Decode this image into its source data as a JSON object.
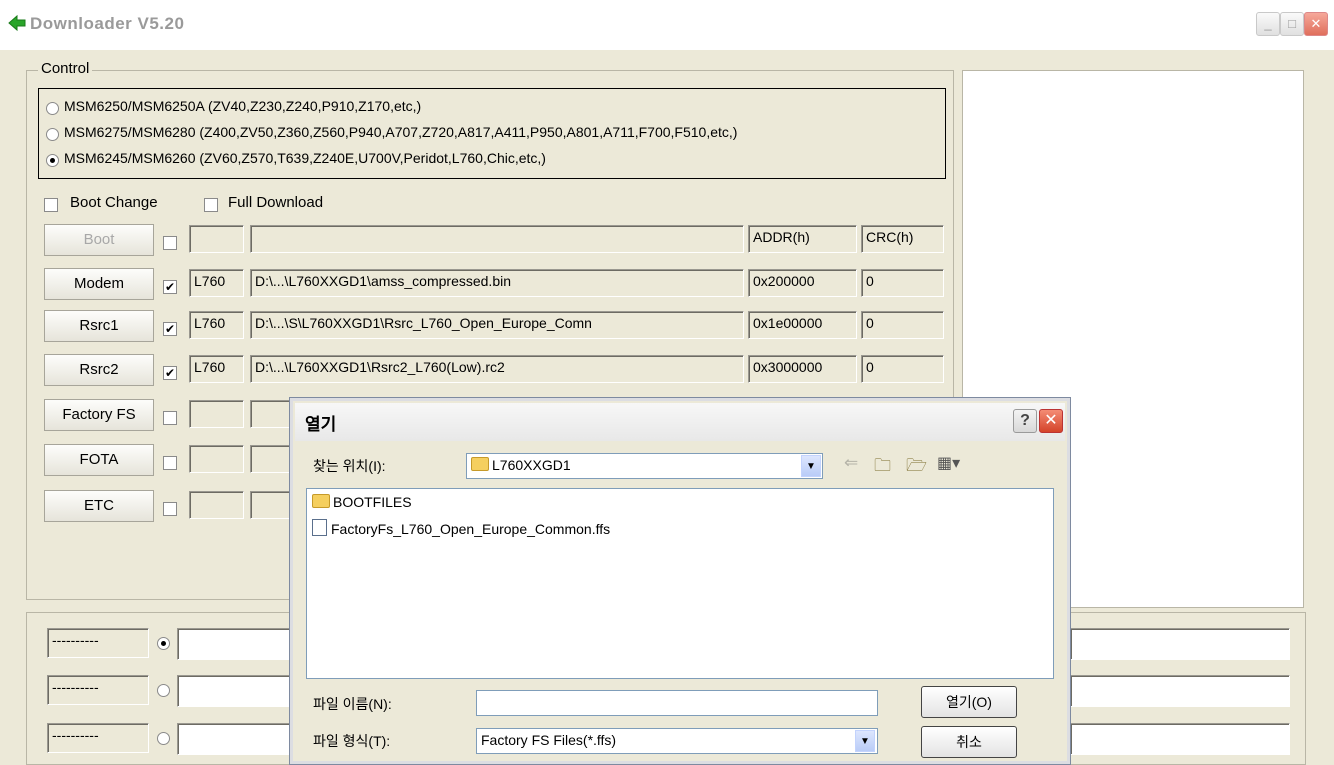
{
  "window": {
    "title": "Downloader V5.20",
    "buttons": [
      "minimize-icon",
      "maximize-icon",
      "close-icon"
    ]
  },
  "control": {
    "label": "Control",
    "chipsets": [
      {
        "label": "MSM6250/MSM6250A (ZV40,Z230,Z240,P910,Z170,etc,)",
        "selected": false
      },
      {
        "label": "MSM6275/MSM6280 (Z400,ZV50,Z360,Z560,P940,A707,Z720,A817,A411,P950,A801,A711,F700,F510,etc,)",
        "selected": false
      },
      {
        "label": "MSM6245/MSM6260 (ZV60,Z570,T639,Z240E,U700V,Peridot,L760,Chic,etc,)",
        "selected": true
      }
    ],
    "boot_change": {
      "label": "Boot Change",
      "checked": false
    },
    "full_download": {
      "label": "Full Download",
      "checked": false
    },
    "headers": {
      "addr": "ADDR(h)",
      "crc": "CRC(h)"
    },
    "rows": [
      {
        "button": "Boot",
        "enabled": false,
        "checked": false,
        "model": "",
        "path": "",
        "addr": "",
        "crc": ""
      },
      {
        "button": "Modem",
        "enabled": true,
        "checked": true,
        "model": "L760",
        "path": "D:\\...\\L760XXGD1\\amss_compressed.bin",
        "addr": "0x200000",
        "crc": "0"
      },
      {
        "button": "Rsrc1",
        "enabled": true,
        "checked": true,
        "model": "L760",
        "path": "D:\\...\\S\\L760XXGD1\\Rsrc_L760_Open_Europe_Comn",
        "addr": "0x1e00000",
        "crc": "0"
      },
      {
        "button": "Rsrc2",
        "enabled": true,
        "checked": true,
        "model": "L760",
        "path": "D:\\...\\L760XXGD1\\Rsrc2_L760(Low).rc2",
        "addr": "0x3000000",
        "crc": "0"
      },
      {
        "button": "Factory FS",
        "enabled": true,
        "checked": false,
        "model": "",
        "path": "",
        "addr": "",
        "crc": ""
      },
      {
        "button": "FOTA",
        "enabled": true,
        "checked": false,
        "model": "",
        "path": "",
        "addr": "",
        "crc": ""
      },
      {
        "button": "ETC",
        "enabled": true,
        "checked": false,
        "model": "",
        "path": "",
        "addr": "",
        "crc": ""
      }
    ]
  },
  "ports": [
    {
      "label": "----------",
      "selected": true
    },
    {
      "label": "----------",
      "selected": false
    },
    {
      "label": "----------",
      "selected": false
    }
  ],
  "open_dialog": {
    "title": "열기",
    "look_in_label": "찾는 위치(I):",
    "look_in_value": "L760XXGD1",
    "files": [
      {
        "name": "BOOTFILES",
        "type": "folder"
      },
      {
        "name": "FactoryFs_L760_Open_Europe_Common.ffs",
        "type": "file"
      }
    ],
    "filename_label": "파일 이름(N):",
    "filename_value": "",
    "filetype_label": "파일 형식(T):",
    "filetype_value": "Factory FS Files(*.ffs)",
    "open_button": "열기(O)",
    "cancel_button": "취소"
  }
}
